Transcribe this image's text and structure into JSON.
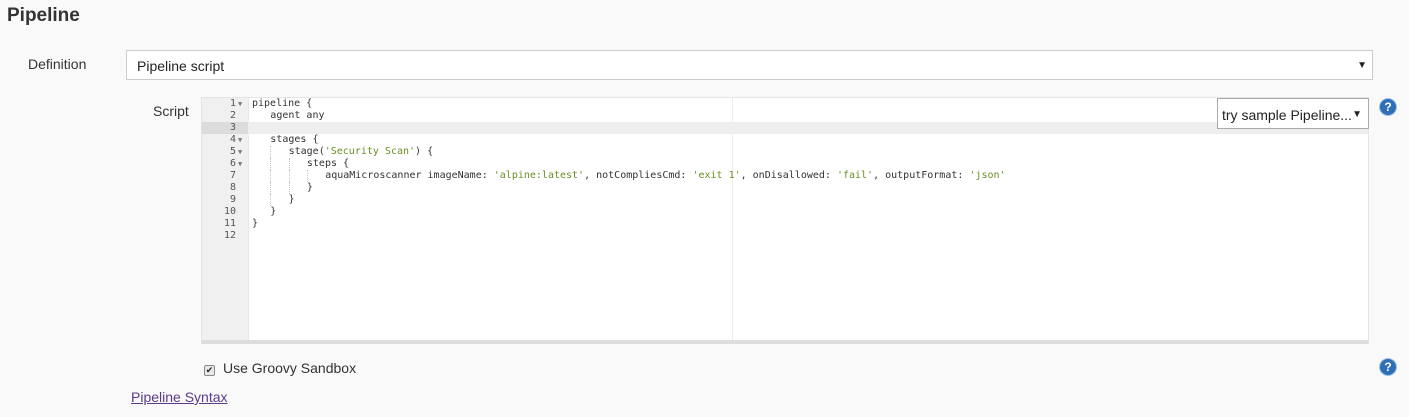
{
  "section": {
    "title": "Pipeline"
  },
  "definition": {
    "label": "Definition",
    "value": "Pipeline script"
  },
  "script": {
    "label": "Script",
    "sample_select": "try sample Pipeline...",
    "lines": [
      {
        "num": "1",
        "fold": true,
        "indent": 0,
        "tokens": [
          [
            "pipeline {",
            ""
          ]
        ]
      },
      {
        "num": "2",
        "fold": false,
        "indent": 1,
        "tokens": [
          [
            "agent any",
            ""
          ]
        ]
      },
      {
        "num": "3",
        "fold": false,
        "indent": 0,
        "tokens": []
      },
      {
        "num": "4",
        "fold": true,
        "indent": 1,
        "tokens": [
          [
            "stages {",
            ""
          ]
        ]
      },
      {
        "num": "5",
        "fold": true,
        "indent": 2,
        "tokens": [
          [
            "stage(",
            ""
          ],
          [
            "'Security Scan'",
            "str"
          ],
          [
            ") {",
            ""
          ]
        ]
      },
      {
        "num": "6",
        "fold": true,
        "indent": 3,
        "tokens": [
          [
            "steps {",
            ""
          ]
        ]
      },
      {
        "num": "7",
        "fold": false,
        "indent": 4,
        "tokens": [
          [
            "aquaMicroscanner imageName: ",
            ""
          ],
          [
            "'alpine:latest'",
            "str"
          ],
          [
            ", notCompliesCmd: ",
            ""
          ],
          [
            "'exit 1'",
            "str"
          ],
          [
            ", onDisallowed: ",
            ""
          ],
          [
            "'fail'",
            "str"
          ],
          [
            ", outputFormat: ",
            ""
          ],
          [
            "'json'",
            "str"
          ]
        ]
      },
      {
        "num": "8",
        "fold": false,
        "indent": 3,
        "tokens": [
          [
            "}",
            ""
          ]
        ]
      },
      {
        "num": "9",
        "fold": false,
        "indent": 2,
        "tokens": [
          [
            "}",
            ""
          ]
        ]
      },
      {
        "num": "10",
        "fold": false,
        "indent": 1,
        "tokens": [
          [
            "}",
            ""
          ]
        ]
      },
      {
        "num": "11",
        "fold": false,
        "indent": 0,
        "tokens": [
          [
            "}",
            ""
          ]
        ]
      },
      {
        "num": "12",
        "fold": false,
        "indent": 0,
        "tokens": []
      }
    ]
  },
  "sandbox": {
    "label": "Use Groovy Sandbox",
    "checked": true
  },
  "syntax_link": "Pipeline Syntax",
  "help_icon_glyph": "?",
  "colors": {
    "string": "#6b8e23",
    "link": "#5b3a8a",
    "help": "#2f6fb5"
  }
}
